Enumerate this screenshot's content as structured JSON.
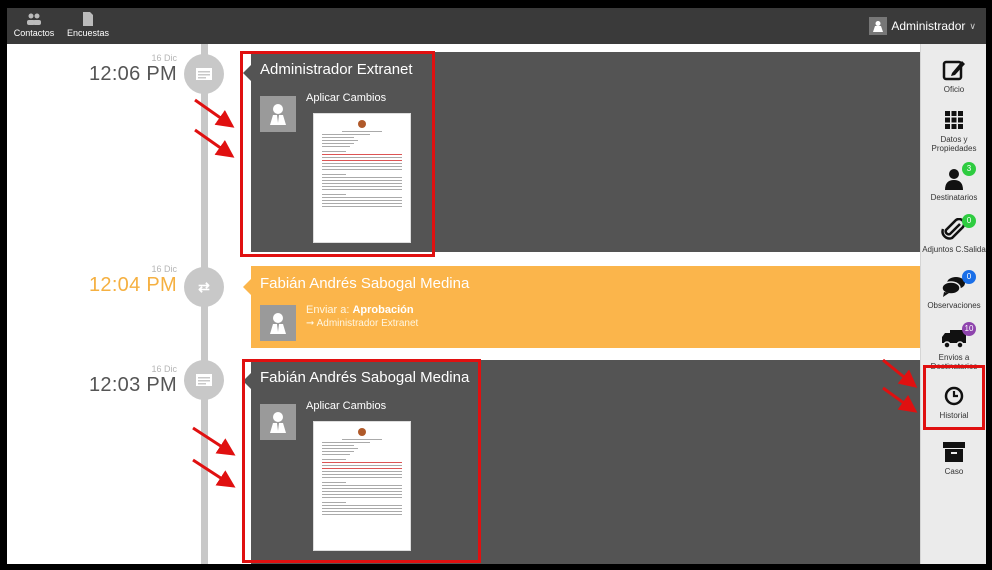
{
  "topbar": {
    "nav": [
      {
        "label": "Contactos",
        "icon": "users-icon"
      },
      {
        "label": "Encuestas",
        "icon": "document-icon"
      }
    ],
    "user": {
      "name": "Administrador",
      "caret": "∨"
    }
  },
  "timeline": [
    {
      "date": "16 Dic",
      "time": "12:06 PM",
      "node_icon": "document-list-icon",
      "author": "Administrador Extranet",
      "action": "Aplicar Cambios",
      "style": "dark"
    },
    {
      "date": "16 Dic",
      "time": "12:04 PM",
      "node_icon": "transfer-arrows-icon",
      "author": "Fabián Andrés Sabogal Medina",
      "action_prefix": "Enviar a: ",
      "action_target": "Aprobación",
      "sub": "➞ Administrador Extranet",
      "style": "orange"
    },
    {
      "date": "16 Dic",
      "time": "12:03 PM",
      "node_icon": "document-list-icon",
      "author": "Fabián Andrés Sabogal Medina",
      "action": "Aplicar Cambios",
      "style": "dark"
    }
  ],
  "sidebar": [
    {
      "label": "Oficio",
      "icon": "edit-icon"
    },
    {
      "label": "Datos y Propiedades",
      "icon": "grid-icon"
    },
    {
      "label": "Destinatarios",
      "icon": "user-icon",
      "badge": "3",
      "badge_color": "#2ecc40"
    },
    {
      "label": "Adjuntos C.Salida",
      "icon": "paperclip-icon",
      "badge": "0",
      "badge_color": "#2ecc40"
    },
    {
      "label": "Observaciones",
      "icon": "comments-icon",
      "badge": "0",
      "badge_color": "#1a6fe8"
    },
    {
      "label": "Envios a Destinatarios",
      "icon": "truck-icon",
      "badge": "10",
      "badge_color": "#8e44ad"
    },
    {
      "label": "Historial",
      "icon": "clock-icon"
    },
    {
      "label": "Caso",
      "icon": "archive-icon"
    }
  ],
  "colors": {
    "topbar": "#3a3a3a",
    "dark_card": "#545454",
    "orange_card": "#fbb54b",
    "annotation": "#e01010"
  }
}
